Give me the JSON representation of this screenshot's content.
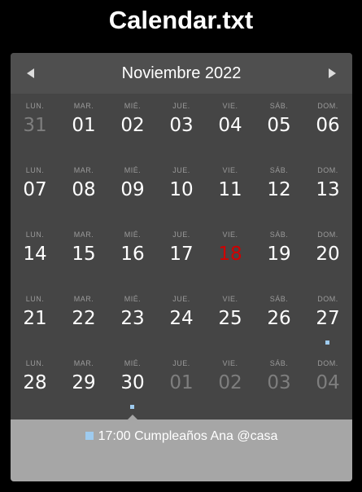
{
  "app": {
    "title": "Calendar.txt"
  },
  "header": {
    "month_label": "Noviembre 2022",
    "prev_icon": "triangle-left-icon",
    "next_icon": "triangle-right-icon"
  },
  "colors": {
    "background": "#000000",
    "calendar_bg": "#454545",
    "header_bg": "#4f4f4f",
    "today": "#d00000",
    "other_month": "#7e7e7e",
    "event_marker": "#9ecbef",
    "events_panel": "#a6a6a6"
  },
  "weeks": [
    [
      {
        "dow": "LUN.",
        "day": "31",
        "other_month": true
      },
      {
        "dow": "MAR.",
        "day": "01"
      },
      {
        "dow": "MIÉ.",
        "day": "02"
      },
      {
        "dow": "JUE.",
        "day": "03"
      },
      {
        "dow": "VIE.",
        "day": "04"
      },
      {
        "dow": "SÁB.",
        "day": "05"
      },
      {
        "dow": "DOM.",
        "day": "06"
      }
    ],
    [
      {
        "dow": "LUN.",
        "day": "07"
      },
      {
        "dow": "MAR.",
        "day": "08"
      },
      {
        "dow": "MIÉ.",
        "day": "09"
      },
      {
        "dow": "JUE.",
        "day": "10"
      },
      {
        "dow": "VIE.",
        "day": "11"
      },
      {
        "dow": "SÁB.",
        "day": "12"
      },
      {
        "dow": "DOM.",
        "day": "13"
      }
    ],
    [
      {
        "dow": "LUN.",
        "day": "14"
      },
      {
        "dow": "MAR.",
        "day": "15"
      },
      {
        "dow": "MIÉ.",
        "day": "16"
      },
      {
        "dow": "JUE.",
        "day": "17"
      },
      {
        "dow": "VIE.",
        "day": "18",
        "today": true
      },
      {
        "dow": "SÁB.",
        "day": "19"
      },
      {
        "dow": "DOM.",
        "day": "20"
      }
    ],
    [
      {
        "dow": "LUN.",
        "day": "21"
      },
      {
        "dow": "MAR.",
        "day": "22"
      },
      {
        "dow": "MIÉ.",
        "day": "23"
      },
      {
        "dow": "JUE.",
        "day": "24"
      },
      {
        "dow": "VIE.",
        "day": "25"
      },
      {
        "dow": "SÁB.",
        "day": "26"
      },
      {
        "dow": "DOM.",
        "day": "27",
        "has_event": true
      }
    ],
    [
      {
        "dow": "LUN.",
        "day": "28"
      },
      {
        "dow": "MAR.",
        "day": "29"
      },
      {
        "dow": "MIÉ.",
        "day": "30",
        "has_event": true,
        "selected": true
      },
      {
        "dow": "JUE.",
        "day": "01",
        "other_month": true
      },
      {
        "dow": "VIE.",
        "day": "02",
        "other_month": true
      },
      {
        "dow": "SÁB.",
        "day": "03",
        "other_month": true
      },
      {
        "dow": "DOM.",
        "day": "04",
        "other_month": true
      }
    ]
  ],
  "events_panel": {
    "items": [
      {
        "text": "17:00 Cumpleaños Ana @casa"
      }
    ]
  }
}
